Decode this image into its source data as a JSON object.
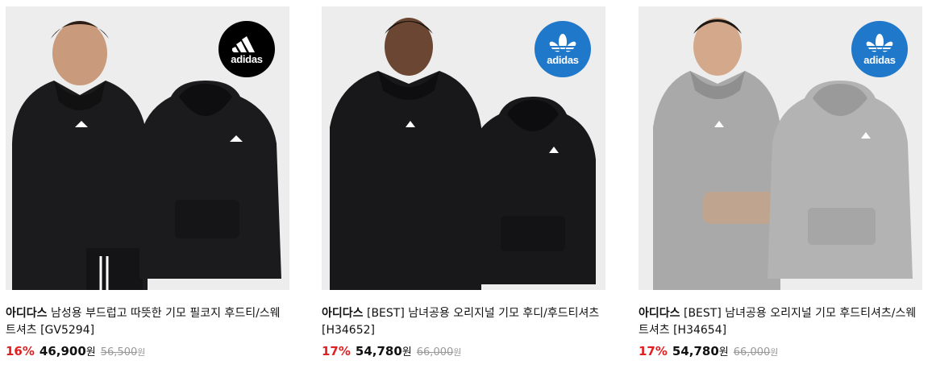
{
  "products": [
    {
      "logo_text": "adidas",
      "logo_color": "#000000",
      "hoodie_color": "#1b1b1d",
      "brand": "아디다스",
      "title": "남성용 부드럽고 따뜻한 기모 필코지 후드티/스웨트셔츠 [GV5294]",
      "discount": "16%",
      "price": "46,900",
      "won": "원",
      "original_price": "56,500",
      "original_won": "원"
    },
    {
      "logo_text": "adidas",
      "logo_color": "#1f78c9",
      "hoodie_color": "#18181a",
      "brand": "아디다스",
      "title": "[BEST] 남녀공용 오리지널 기모 후디/후드티셔츠 [H34652]",
      "discount": "17%",
      "price": "54,780",
      "won": "원",
      "original_price": "66,000",
      "original_won": "원"
    },
    {
      "logo_text": "adidas",
      "logo_color": "#1f78c9",
      "hoodie_color": "#a9a9a9",
      "brand": "아디다스",
      "title": "[BEST] 남녀공용 오리지널 기모 후드티셔츠/스웨트셔츠 [H34654]",
      "discount": "17%",
      "price": "54,780",
      "won": "원",
      "original_price": "66,000",
      "original_won": "원"
    }
  ]
}
